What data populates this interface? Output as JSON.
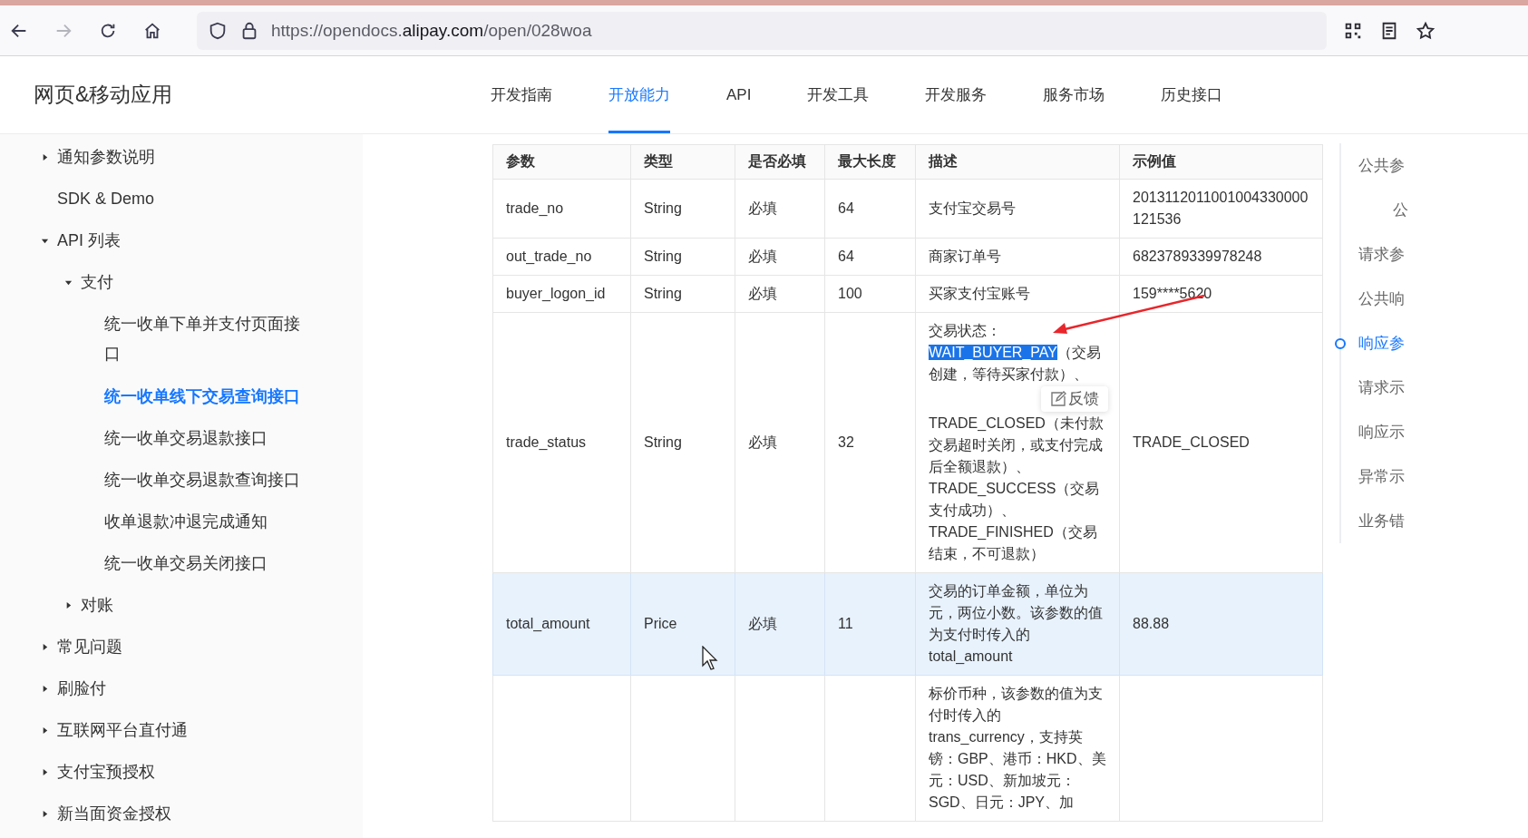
{
  "browser": {
    "url_prefix": "https://opendocs.",
    "url_host": "alipay.com",
    "url_path": "/open/028woa",
    "forward_disabled": true
  },
  "header": {
    "title": "网页&移动应用",
    "tabs": [
      {
        "label": "开发指南",
        "selected": false
      },
      {
        "label": "开放能力",
        "selected": true
      },
      {
        "label": "API",
        "selected": false
      },
      {
        "label": "开发工具",
        "selected": false
      },
      {
        "label": "开发服务",
        "selected": false
      },
      {
        "label": "服务市场",
        "selected": false
      },
      {
        "label": "历史接口",
        "selected": false
      }
    ]
  },
  "sidebar": {
    "items": [
      {
        "children": [
          {
            "label": "通知参数说明",
            "expanded": false,
            "selected": false
          },
          {
            "label": "SDK & Demo",
            "selected": false
          },
          {
            "label": "API 列表",
            "expanded": true,
            "selected": false,
            "children": [
              {
                "label": "支付",
                "expanded": true,
                "selected": false,
                "children": [
                  {
                    "label": "统一收单下单并支付页面接口",
                    "selected": false
                  },
                  {
                    "label": "统一收单线下交易查询接口",
                    "selected": true
                  },
                  {
                    "label": "统一收单交易退款接口",
                    "selected": false
                  },
                  {
                    "label": "统一收单交易退款查询接口",
                    "selected": false
                  },
                  {
                    "label": "收单退款冲退完成通知",
                    "selected": false
                  },
                  {
                    "label": "统一收单交易关闭接口",
                    "selected": false
                  }
                ]
              },
              {
                "label": "对账",
                "expanded": false,
                "selected": false
              }
            ]
          },
          {
            "label": "常见问题",
            "expanded": false,
            "selected": false
          }
        ]
      },
      {
        "label": "刷脸付",
        "expanded": false,
        "selected": false
      },
      {
        "label": "互联网平台直付通",
        "expanded": false,
        "selected": false
      },
      {
        "label": "支付宝预授权",
        "expanded": false,
        "selected": false
      },
      {
        "label": "新当面资金授权",
        "expanded": false,
        "selected": false
      }
    ]
  },
  "table": {
    "columns": [
      "参数",
      "类型",
      "是否必填",
      "最大长度",
      "描述",
      "示例值"
    ],
    "rows": [
      {
        "selected": false,
        "param": "trade_no",
        "type": "String",
        "required": "必填",
        "max_length": "64",
        "description": [
          {
            "text": "支付宝交易号",
            "selected": false
          }
        ],
        "example": "2013112011001004330000121536"
      },
      {
        "selected": false,
        "param": "out_trade_no",
        "type": "String",
        "required": "必填",
        "max_length": "64",
        "description": [
          {
            "text": "商家订单号",
            "selected": false
          }
        ],
        "example": "6823789339978248"
      },
      {
        "selected": false,
        "param": "buyer_logon_id",
        "type": "String",
        "required": "必填",
        "max_length": "100",
        "description": [
          {
            "text": "买家支付宝账号",
            "selected": false
          }
        ],
        "example": "159****5620"
      },
      {
        "selected": false,
        "param": "trade_status",
        "type": "String",
        "required": "必填",
        "max_length": "32",
        "description": [
          {
            "text": "交易状态：",
            "selected": false
          },
          {
            "text": "WAIT_BUYER_PAY",
            "selected": true
          },
          {
            "text": "（交易创建，等待买家付款）、",
            "selected": false,
            "tooltip": "反馈"
          },
          {
            "text": "TRADE_CLOSED（未付款交易超时关闭，或支付完成后全额退款）、TRADE_SUCCESS（交易支付成功）、TRADE_FINISHED（交易结束，不可退款）",
            "selected": false
          }
        ],
        "example": "TRADE_CLOSED"
      },
      {
        "selected": true,
        "param": "total_amount",
        "type": "Price",
        "required": "必填",
        "max_length": "11",
        "description": [
          {
            "text": "交易的订单金额，单位为元，两位小数。该参数的值为支付时传入的total_amount",
            "selected": false
          }
        ],
        "example": "88.88"
      },
      {
        "selected": false,
        "description": [
          {
            "text": "标价币种，该参数的值为支付时传入的trans_currency，支持英镑：GBP、港币：HKD、美元：USD、新加坡元：SGD、日元：JPY、加",
            "selected": false
          }
        ]
      }
    ]
  },
  "toc": {
    "items": [
      {
        "label": "公共参",
        "selected": false,
        "nested": false
      },
      {
        "label": "公",
        "selected": false,
        "nested": true
      },
      {
        "label": "请求参",
        "selected": false,
        "nested": false
      },
      {
        "label": "公共响",
        "selected": false,
        "nested": false
      },
      {
        "label": "响应参",
        "selected": true,
        "nested": false
      },
      {
        "label": "请求示",
        "selected": false,
        "nested": false
      },
      {
        "label": "响应示",
        "selected": false,
        "nested": false
      },
      {
        "label": "异常示",
        "selected": false,
        "nested": false
      },
      {
        "label": "业务错",
        "selected": false,
        "nested": false
      }
    ]
  }
}
